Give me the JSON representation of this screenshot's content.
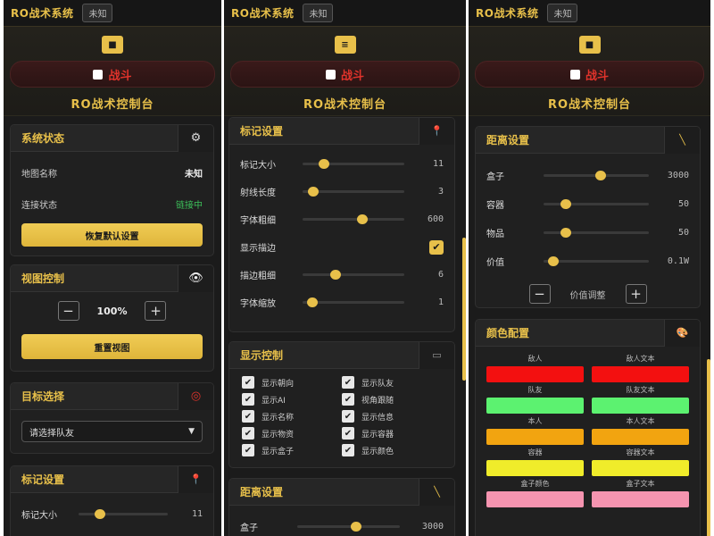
{
  "app": {
    "title": "RO战术系统",
    "status": "未知",
    "fight_label": "战斗",
    "console_title": "RO战术控制台",
    "menu_glyph": "■",
    "menu_glyph2": "≡"
  },
  "system": {
    "title": "系统状态",
    "map_label": "地图名称",
    "map_value": "未知",
    "conn_label": "连接状态",
    "conn_value": "链接中",
    "restore": "恢复默认设置"
  },
  "view": {
    "title": "视图控制",
    "zoom": "100%",
    "minus": "−",
    "plus": "+",
    "reset": "重置视图"
  },
  "target": {
    "title": "目标选择",
    "placeholder": "请选择队友"
  },
  "marker": {
    "title": "标记设置",
    "items": [
      {
        "label": "标记大小",
        "value": "11",
        "pos": 0.18
      },
      {
        "label": "射线长度",
        "value": "3",
        "pos": 0.06
      },
      {
        "label": "字体粗细",
        "value": "600",
        "pos": 0.6
      },
      {
        "label": "显示描边",
        "value": "✔"
      },
      {
        "label": "描边粗细",
        "value": "6",
        "pos": 0.3
      },
      {
        "label": "字体缩放",
        "value": "1",
        "pos": 0.05
      }
    ]
  },
  "display": {
    "title": "显示控制",
    "left": [
      "显示朝向",
      "显示AI",
      "显示名称",
      "显示物资",
      "显示盒子"
    ],
    "right": [
      "显示队友",
      "视角跟随",
      "显示信息",
      "显示容器",
      "显示颜色"
    ]
  },
  "distance": {
    "title": "距离设置",
    "items": [
      {
        "label": "盒子",
        "value": "3000",
        "pos": 0.55
      },
      {
        "label": "容器",
        "value": "50",
        "pos": 0.18
      },
      {
        "label": "物品",
        "value": "50",
        "pos": 0.18
      },
      {
        "label": "价值",
        "value": "0.1W",
        "pos": 0.05
      }
    ],
    "value_adjust": "价值调整"
  },
  "colors": {
    "title": "颜色配置",
    "pairs": [
      {
        "a": "敌人",
        "ac": "#f31010",
        "b": "敌人文本",
        "bc": "#f31010"
      },
      {
        "a": "队友",
        "ac": "#5cf270",
        "b": "队友文本",
        "bc": "#5cf270"
      },
      {
        "a": "本人",
        "ac": "#f2a410",
        "b": "本人文本",
        "bc": "#f2a410"
      },
      {
        "a": "容器",
        "ac": "#f0ec2a",
        "b": "容器文本",
        "bc": "#f0ec2a"
      },
      {
        "a": "盒子颜色",
        "ac": "#f594b0",
        "b": "盒子文本",
        "bc": "#f594b0"
      }
    ]
  },
  "colors_theme": {
    "accent": "#e8c04a",
    "panel": "#1b1b1b",
    "danger": "#e0332b",
    "ok": "#3cc05a"
  }
}
